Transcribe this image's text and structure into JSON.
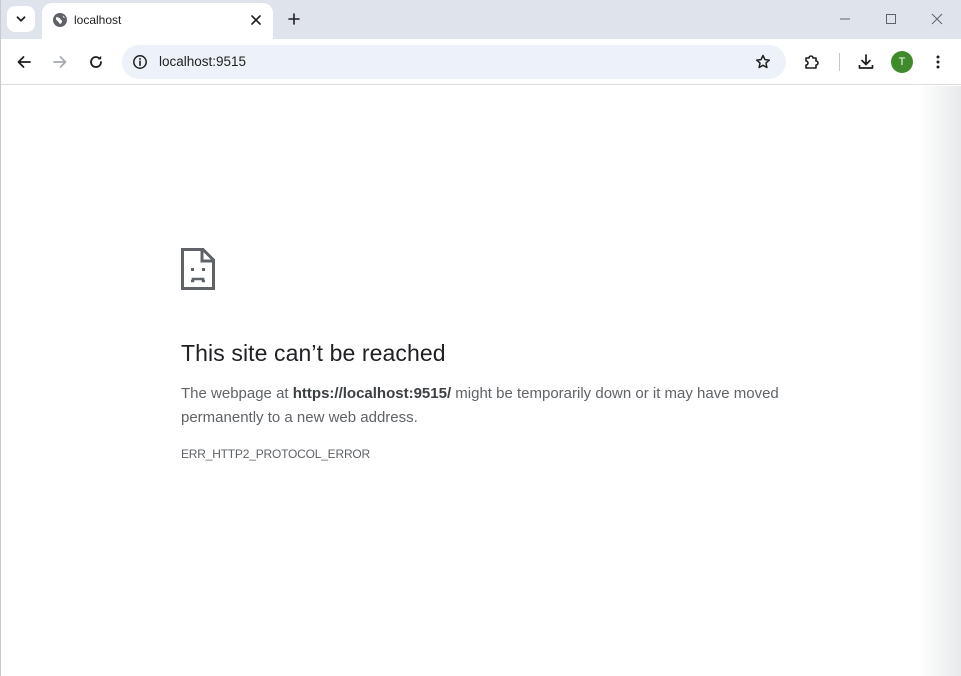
{
  "tab": {
    "title": "localhost"
  },
  "toolbar": {
    "url": "localhost:9515",
    "avatar_initial": "T"
  },
  "error": {
    "title": "This site can’t be reached",
    "desc_prefix": "The webpage at ",
    "desc_url": "https://localhost:9515/",
    "desc_suffix": " might be temporarily down or it may have moved permanently to a new web address.",
    "code": "ERR_HTTP2_PROTOCOL_ERROR"
  },
  "colors": {
    "tabstrip_bg": "#dfe3eb",
    "omnibox_bg": "#edf2fa",
    "avatar_bg": "#3f8b2c",
    "text_primary": "#202124",
    "text_secondary": "#5f6368"
  },
  "icons": {
    "tab_search": "chevron-down-icon",
    "favicon": "globe-icon",
    "tab_close": "close-icon",
    "new_tab": "plus-icon",
    "minimize": "minimize-icon",
    "maximize": "maximize-icon",
    "close_window": "close-icon",
    "back": "arrow-left-icon",
    "forward": "arrow-right-icon",
    "reload": "reload-icon",
    "site_info": "info-icon",
    "bookmark": "star-icon",
    "extensions": "puzzle-icon",
    "downloads": "download-icon",
    "menu": "more-vert-icon",
    "error": "sad-document-icon"
  }
}
